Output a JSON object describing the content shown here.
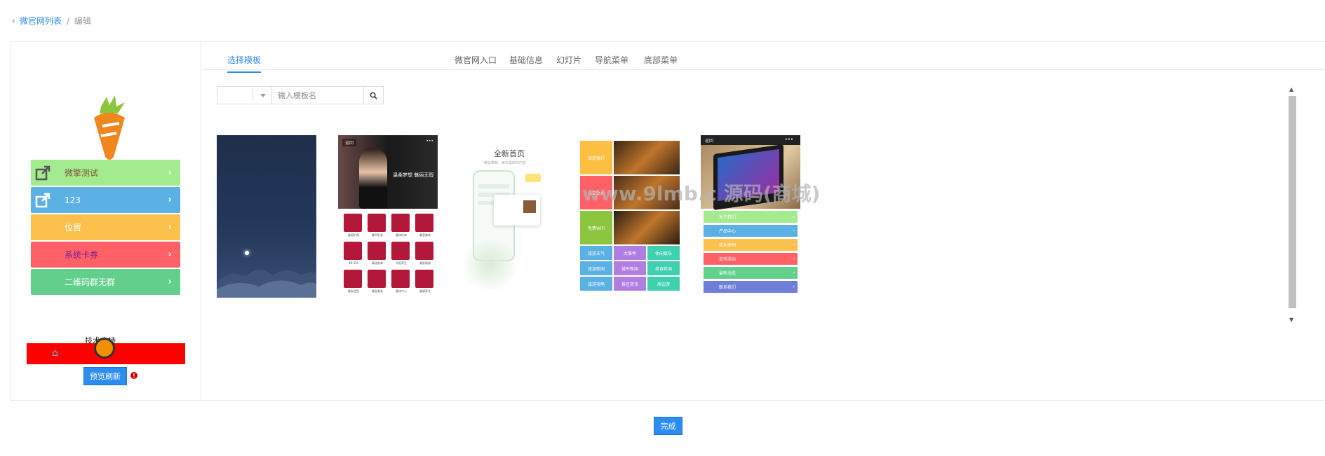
{
  "breadcrumb": {
    "parent": "微官网列表",
    "separator": "/",
    "current": "编辑"
  },
  "tabs": [
    "选择模板",
    "微官网入口",
    "基础信息",
    "幻灯片",
    "导航菜单",
    "底部菜单"
  ],
  "preview": {
    "menu": [
      {
        "label": "微擎测试",
        "color": "#a4ea8e",
        "icon": "external-link-icon",
        "text_color": "#7a5a3c"
      },
      {
        "label": "123",
        "color": "#5bb1e4",
        "icon": "external-link-icon",
        "text_color": "#ffffff"
      },
      {
        "label": "位置",
        "color": "#fcc14d",
        "icon": "",
        "text_color": "#ffffff"
      },
      {
        "label": "系统卡券",
        "color": "#ff6167",
        "icon": "",
        "text_color": "#7a1a8f"
      },
      {
        "label": "二维码群无群",
        "color": "#62d08c",
        "icon": "",
        "text_color": "#ffffff"
      }
    ],
    "tech_text": "技术支持",
    "preview_button": "预览刷新",
    "home_icon": "home-icon",
    "bottom_bar_color": "#ff0000"
  },
  "filter": {
    "placeholder": "输入模板名",
    "select_value": "",
    "search_icon": "search-icon"
  },
  "templates": {
    "t3_title": "全新首页",
    "t3_sub": "精选推荐，每天最新的内容",
    "t2_tags": [
      "返回",
      "•••"
    ],
    "t2_headline": "温柔梦想 魅丽无瑕",
    "t2_items": [
      "美容护理",
      "美甲彩妆",
      "美体纤体",
      "美容美体",
      "4D SPA",
      "精油推拿",
      "中医养生",
      "美肤焕颜",
      "美发造型",
      "美容美发",
      "美体中心",
      "健康养生"
    ],
    "t4_cells": [
      "旅游预订",
      "公交站点",
      "免费WiFi",
      "旅游天气",
      "大事件",
      "休闲娱乐",
      "旅游新闻",
      "城市新闻",
      "美食新闻",
      "旅游攻略",
      "景区资讯",
      "周边游"
    ],
    "t5_menu": [
      "关于我们",
      "产品中心",
      "成功案例",
      "促销活动",
      "最新动态",
      "联系我们"
    ],
    "t5_tags": [
      "返回",
      "•••"
    ]
  },
  "watermark": "www.9lmb.c 源码(商城)",
  "done_button": "完成"
}
